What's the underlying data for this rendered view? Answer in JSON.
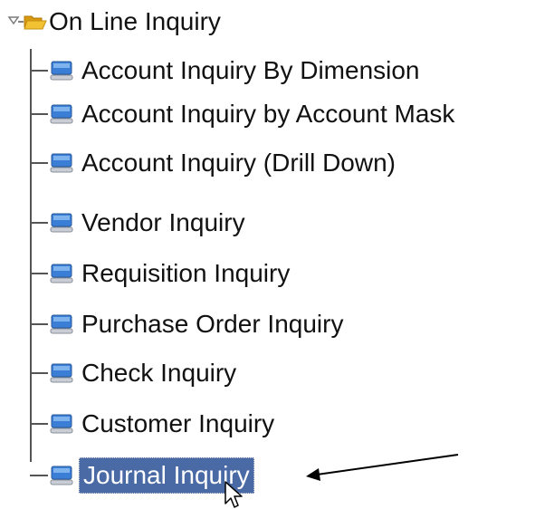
{
  "tree": {
    "root": {
      "label": "On Line Inquiry",
      "expander_icon": "collapse-toggle-icon",
      "icon": "open-folder-icon",
      "expanded": true
    },
    "items": [
      {
        "label": "Account Inquiry By Dimension",
        "icon": "computer-icon",
        "selected": false
      },
      {
        "label": "Account Inquiry by Account Mask",
        "icon": "computer-icon",
        "selected": false
      },
      {
        "label": "Account Inquiry (Drill Down)",
        "icon": "computer-icon",
        "selected": false
      },
      {
        "label": "Vendor Inquiry",
        "icon": "computer-icon",
        "selected": false
      },
      {
        "label": "Requisition Inquiry",
        "icon": "computer-icon",
        "selected": false
      },
      {
        "label": "Purchase Order Inquiry",
        "icon": "computer-icon",
        "selected": false
      },
      {
        "label": "Check Inquiry",
        "icon": "computer-icon",
        "selected": false
      },
      {
        "label": "Customer Inquiry",
        "icon": "computer-icon",
        "selected": false
      },
      {
        "label": "Journal Inquiry",
        "icon": "computer-icon",
        "selected": true
      }
    ]
  },
  "colors": {
    "selection": "#4a6aa5",
    "tree_lines": "#555555",
    "folder": "#f2b820",
    "computer": "#3a7fd5"
  },
  "annotation": {
    "icon": "pointing-arrow-icon"
  },
  "cursor": {
    "icon": "mouse-pointer-icon"
  }
}
